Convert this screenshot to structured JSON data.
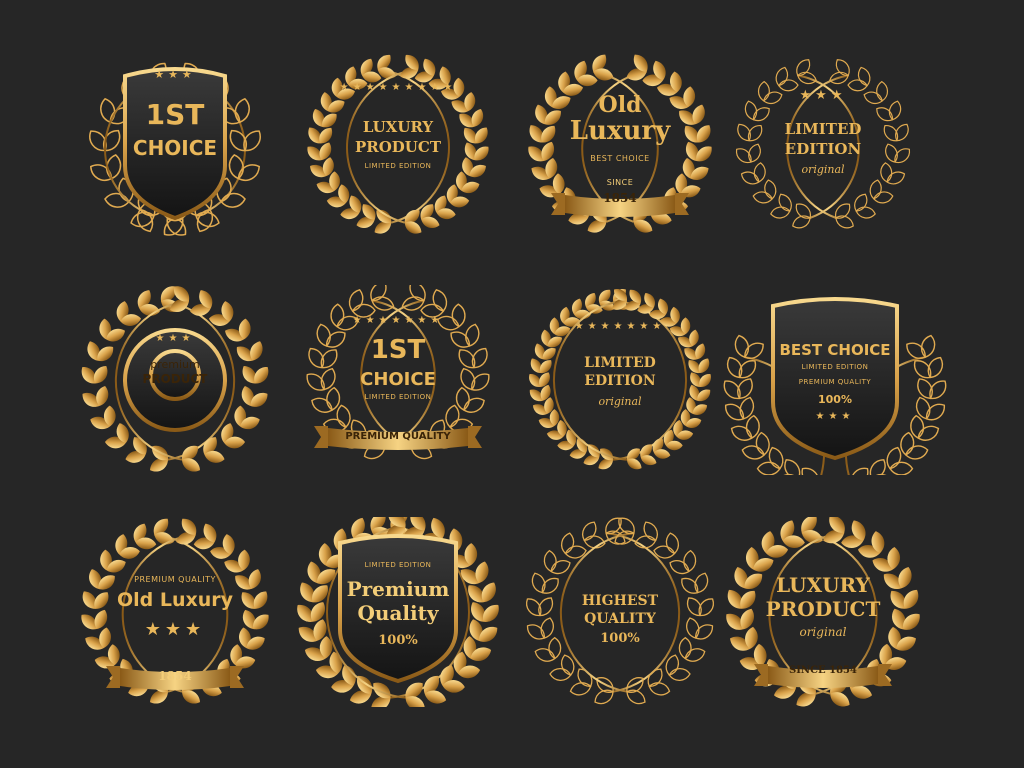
{
  "colors": {
    "background": "#262626",
    "gold": "#e9b75a",
    "gold_light": "#f8d98e",
    "gold_dark": "#8a5a17",
    "panel": "#1d1d1d"
  },
  "badges": [
    {
      "id": "r1c1",
      "lines": [
        "1ST",
        "CHOICE"
      ],
      "icon": "flourish-icon",
      "stars": "★★★"
    },
    {
      "id": "r1c2",
      "lines": [
        "LUXURY",
        "PRODUCT"
      ],
      "sub": "LIMITED EDITION",
      "stars": "★★★★★★★★★"
    },
    {
      "id": "r1c3",
      "lines": [
        "Old",
        "Luxury"
      ],
      "sub": "BEST CHOICE",
      "ribbon": [
        "SINCE",
        "1854"
      ]
    },
    {
      "id": "r1c4",
      "lines": [
        "LIMITED",
        "EDITION"
      ],
      "sub": "original",
      "stars": "★★★"
    },
    {
      "id": "r2c1",
      "lines": [
        "premium",
        "PRODUCT"
      ],
      "stars": "★★★"
    },
    {
      "id": "r2c2",
      "lines": [
        "1ST",
        "CHOICE"
      ],
      "sub": "LIMITED EDITION",
      "ribbon": [
        "PREMIUM QUALITY"
      ],
      "stars": "★★★★★★★"
    },
    {
      "id": "r2c3",
      "lines": [
        "LIMITED",
        "EDITION"
      ],
      "sub": "original",
      "stars": "★★★★★★★"
    },
    {
      "id": "r2c4",
      "lines": [
        "BEST CHOICE"
      ],
      "sub": "LIMITED EDITION",
      "ribbon": [
        "PREMIUM QUALITY"
      ],
      "extra": "100%",
      "stars": "★★★"
    },
    {
      "id": "r3c1",
      "lines": [
        "Old Luxury"
      ],
      "sub": "PREMIUM QUALITY",
      "ribbon": [
        "1854"
      ],
      "stars": "★★★"
    },
    {
      "id": "r3c2",
      "lines": [
        "Premium",
        "Quality"
      ],
      "sub": "LIMITED EDITION",
      "extra": "100%"
    },
    {
      "id": "r3c3",
      "lines": [
        "HIGHEST",
        "QUALITY"
      ],
      "extra": "100%"
    },
    {
      "id": "r3c4",
      "lines": [
        "LUXURY",
        "PRODUCT"
      ],
      "sub": "original",
      "ribbon": [
        "SINCE 1854"
      ]
    }
  ]
}
